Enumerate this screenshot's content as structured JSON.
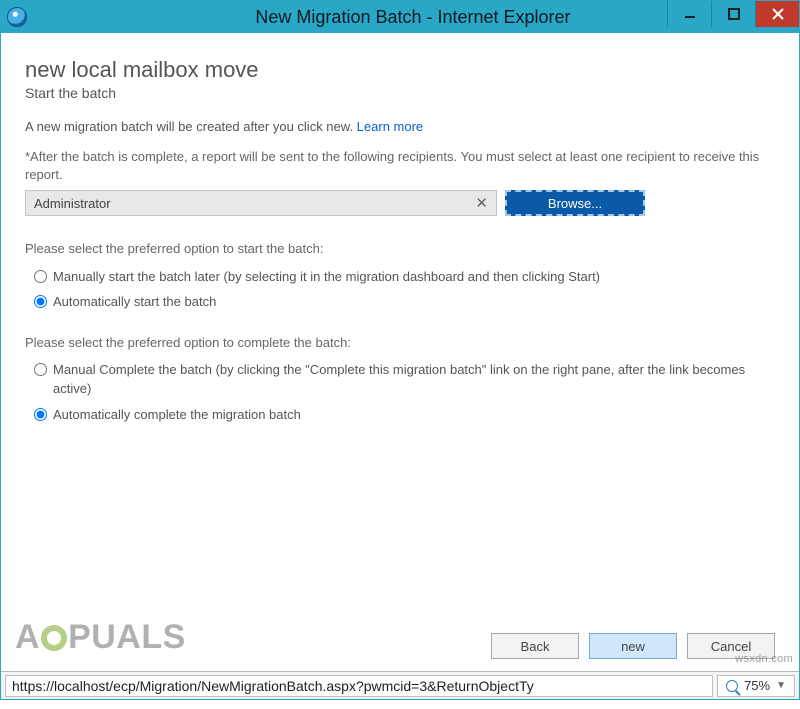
{
  "window": {
    "title": "New Migration Batch - Internet Explorer"
  },
  "main": {
    "page_title": "new local mailbox move",
    "subtitle": "Start the batch",
    "intro_text": "A new migration batch will be created after you click new. ",
    "learn_more": "Learn more",
    "recipients_instruction": "*After the batch is complete, a report will be sent to the following recipients. You must select at least one recipient to receive this report.",
    "recipient_value": "Administrator",
    "browse_label": "Browse...",
    "start_prompt": "Please select the preferred option to start the batch:",
    "start_options": {
      "manual": "Manually start the batch later (by selecting it in the migration dashboard and then clicking Start)",
      "auto": "Automatically start the batch",
      "selected": "auto"
    },
    "complete_prompt": "Please select the preferred option to complete the batch:",
    "complete_options": {
      "manual": "Manual Complete the batch (by clicking the \"Complete this migration batch\" link on the right pane, after the link becomes active)",
      "auto": "Automatically complete the migration batch",
      "selected": "auto"
    }
  },
  "footer": {
    "back": "Back",
    "new": "new",
    "cancel": "Cancel"
  },
  "statusbar": {
    "url": "https://localhost/ecp/Migration/NewMigrationBatch.aspx?pwmcid=3&ReturnObjectTy",
    "zoom": "75%"
  },
  "watermark": {
    "logo_prefix": "A",
    "logo_mid": "PU",
    "logo_suffix": "ALS",
    "site": "wsxdn.com"
  }
}
